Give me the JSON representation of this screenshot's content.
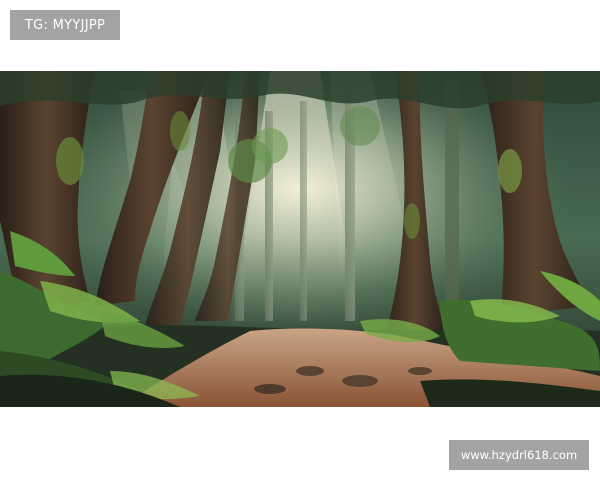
{
  "watermarks": {
    "top_left": "TG: MYYJJPP",
    "bottom_right": "www.hzydrl618.com"
  },
  "colors": {
    "page_background": "#ffffff",
    "badge_background": "#a3a3a3",
    "badge_text": "#ffffff",
    "forest_dark": "#1c2a20",
    "forest_mid": "#3b5a3c",
    "light_haze": "#f3efd6",
    "path": "#a86c47",
    "fern_green": "#7fb24a"
  }
}
